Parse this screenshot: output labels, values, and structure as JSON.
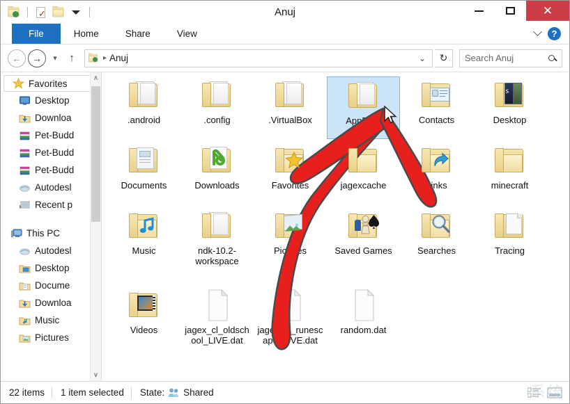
{
  "window": {
    "title": "Anuj",
    "quick_access": [
      "user-folder-icon",
      "new-folder-properties-icon",
      "new-folder-icon",
      "customize-dropdown-icon"
    ],
    "controls": {
      "minimize": "–",
      "maximize": "□",
      "close": "✕",
      "close_color": "#cd3d45"
    }
  },
  "ribbon": {
    "tabs": [
      {
        "label": "File",
        "active": true,
        "accent": "#1e70c0"
      },
      {
        "label": "Home",
        "active": false
      },
      {
        "label": "Share",
        "active": false
      },
      {
        "label": "View",
        "active": false
      }
    ],
    "collapse_icon": "chevron-down-icon",
    "help_icon": "help-icon",
    "help_glyph": "?"
  },
  "address_bar": {
    "back_glyph": "←",
    "forward_glyph": "→",
    "recent_glyph": "▾",
    "up_glyph": "↑",
    "breadcrumb_icon": "user-folder-icon",
    "breadcrumb": [
      "Anuj"
    ],
    "breadcrumb_separator": "▸",
    "dropdown_glyph": "⌄",
    "refresh_glyph": "↻",
    "search": {
      "placeholder": "Search Anuj",
      "icon": "search-icon"
    }
  },
  "sidebar": {
    "scroll": {
      "up_glyph": "∧",
      "down_glyph": "∨"
    },
    "sections": [
      {
        "name": "Favorites",
        "icon": "star-icon",
        "items": [
          {
            "label": "Desktop",
            "icon": "desktop-icon"
          },
          {
            "label": "Downloa",
            "icon": "downloads-folder-icon"
          },
          {
            "label": "Pet-Budd",
            "icon": "library-icon"
          },
          {
            "label": "Pet-Budd",
            "icon": "library-icon"
          },
          {
            "label": "Pet-Budd",
            "icon": "library-icon"
          },
          {
            "label": "Autodesl",
            "icon": "autodesk-cloud-icon"
          },
          {
            "label": "Recent p",
            "icon": "recent-places-icon"
          }
        ]
      },
      {
        "name": "This PC",
        "icon": "this-pc-icon",
        "items": [
          {
            "label": "Autodesl",
            "icon": "autodesk-cloud-icon"
          },
          {
            "label": "Desktop",
            "icon": "desktop-folder-icon"
          },
          {
            "label": "Docume",
            "icon": "documents-folder-icon"
          },
          {
            "label": "Downloa",
            "icon": "downloads-folder-icon"
          },
          {
            "label": "Music",
            "icon": "music-folder-icon"
          },
          {
            "label": "Pictures",
            "icon": "pictures-folder-icon"
          }
        ]
      }
    ]
  },
  "content": {
    "items": [
      {
        "label": ".android",
        "icon": "folder-open-documents-icon",
        "type": "folder",
        "selected": false
      },
      {
        "label": ".config",
        "icon": "folder-open-documents-icon",
        "type": "folder",
        "selected": false
      },
      {
        "label": ".VirtualBox",
        "icon": "folder-open-documents-icon",
        "type": "folder",
        "selected": false
      },
      {
        "label": "AppData",
        "icon": "folder-open-documents-icon",
        "type": "folder",
        "selected": true
      },
      {
        "label": "Contacts",
        "icon": "folder-contacts-icon",
        "type": "folder",
        "selected": false
      },
      {
        "label": "Desktop",
        "icon": "folder-desktop-icon",
        "type": "folder",
        "selected": false
      },
      {
        "label": "Documents",
        "icon": "folder-documents-icon",
        "type": "folder",
        "selected": false
      },
      {
        "label": "Downloads",
        "icon": "folder-downloads-icon",
        "type": "folder",
        "selected": false
      },
      {
        "label": "Favorites",
        "icon": "folder-favorites-icon",
        "type": "folder",
        "selected": false
      },
      {
        "label": "jagexcache",
        "icon": "folder-plain-icon",
        "type": "folder",
        "selected": false
      },
      {
        "label": "Links",
        "icon": "folder-links-icon",
        "type": "folder",
        "selected": false
      },
      {
        "label": "minecraft",
        "icon": "folder-plain-icon",
        "type": "folder",
        "selected": false
      },
      {
        "label": "Music",
        "icon": "folder-music-icon",
        "type": "folder",
        "selected": false
      },
      {
        "label": "ndk-10.2-workspace",
        "icon": "folder-open-documents-icon",
        "type": "folder",
        "selected": false
      },
      {
        "label": "Pictures",
        "icon": "folder-pictures-icon",
        "type": "folder",
        "selected": false
      },
      {
        "label": "Saved Games",
        "icon": "folder-saved-games-icon",
        "type": "folder",
        "selected": false
      },
      {
        "label": "Searches",
        "icon": "folder-searches-icon",
        "type": "folder",
        "selected": false
      },
      {
        "label": "Tracing",
        "icon": "folder-tracing-icon",
        "type": "folder",
        "selected": false
      },
      {
        "label": "Videos",
        "icon": "folder-videos-icon",
        "type": "folder",
        "selected": false
      },
      {
        "label": "jagex_cl_oldschool_LIVE.dat",
        "icon": "dat-file-icon",
        "type": "file",
        "selected": false
      },
      {
        "label": "jagex_cl_runescape_LIVE.dat",
        "icon": "dat-file-icon",
        "type": "file",
        "selected": false
      },
      {
        "label": "random.dat",
        "icon": "dat-file-icon",
        "type": "file",
        "selected": false
      }
    ],
    "cursor": "arrow-cursor",
    "annotation": {
      "type": "red-arrow",
      "color": "#e8201d",
      "points_to": "AppData"
    }
  },
  "status_bar": {
    "item_count": "22 items",
    "selection": "1 item selected",
    "state_label": "State:",
    "state_icon": "shared-users-icon",
    "state_value": "Shared",
    "view_modes": [
      "details-view-icon",
      "large-icons-view-icon"
    ]
  },
  "watermark": "系统"
}
